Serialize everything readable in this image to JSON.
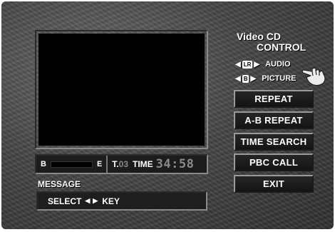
{
  "panel": {
    "title_line1": "Video CD",
    "title_line2": "CONTROL"
  },
  "selectors": {
    "audio": {
      "chip": "LR",
      "label": "AUDIO"
    },
    "picture": {
      "chip": "B",
      "label": "PICTURE"
    }
  },
  "menu": [
    {
      "label": "REPEAT"
    },
    {
      "label": "A-B REPEAT"
    },
    {
      "label": "TIME SEARCH"
    },
    {
      "label": "PBC CALL"
    },
    {
      "label": "EXIT"
    }
  ],
  "status": {
    "ab_start": "B",
    "ab_end": "E",
    "track_prefix": "T.",
    "track_number": "03",
    "time_label": "TIME",
    "time_value": "34:58"
  },
  "message": {
    "label": "MESSAGE",
    "text_pre": "SELECT",
    "text_post": "KEY"
  }
}
